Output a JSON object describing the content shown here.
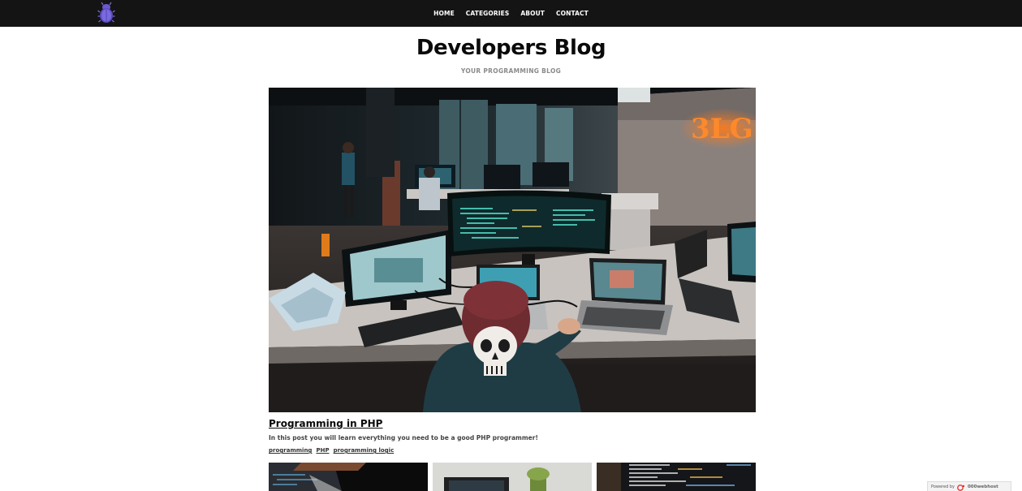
{
  "header": {
    "logo_icon": "bug-icon",
    "nav": [
      {
        "label": "HOME"
      },
      {
        "label": "CATEGORIES"
      },
      {
        "label": "ABOUT"
      },
      {
        "label": "CONTACT"
      }
    ]
  },
  "site": {
    "title": "Developers Blog",
    "tagline": "YOUR PROGRAMMING BLOG"
  },
  "featured_post": {
    "image_icon": "hacker-workstation-photo",
    "title": "Programming in PHP",
    "excerpt": "In this post you will learn everything you need to be a good PHP programmer!",
    "tags": [
      "programming",
      "PHP",
      "programming logic"
    ]
  },
  "more_posts": [
    {
      "image_icon": "code-screen-photo"
    },
    {
      "image_icon": "laptop-desk-photo"
    },
    {
      "image_icon": "code-editor-photo"
    }
  ],
  "footer_badge": {
    "powered_label": "Powered by",
    "host_label": "000webhost"
  },
  "colors": {
    "topbar": "#141414",
    "accent_purple": "#6a5acd"
  }
}
